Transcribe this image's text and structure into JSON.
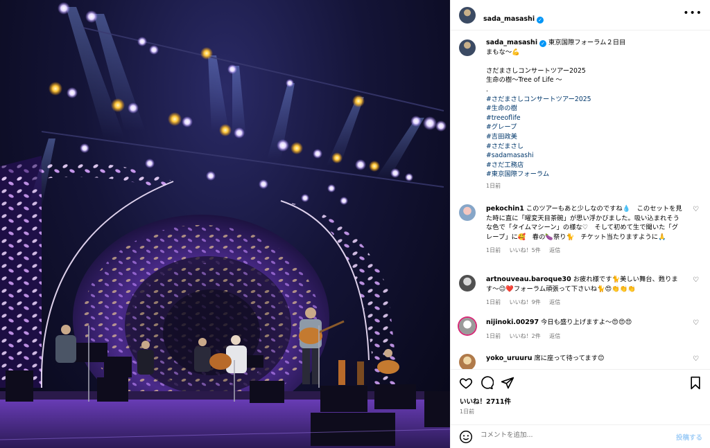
{
  "post": {
    "username": "sada_masashi",
    "verified_icon": "verified-badge-icon",
    "more_icon": "more-options-icon"
  },
  "caption": {
    "username": "sada_masashi",
    "line1": "東京国際フォーラム２日目",
    "line2": "まもな〜💪",
    "line3": "さだまさしコンサートツアー2025",
    "line4": "生命の樹〜Tree of Life 〜",
    "line5": ".",
    "hashtags": [
      "#さだまさしコンサートツアー2025",
      "#生命の樹",
      "#treeoflife",
      "#グレープ",
      "#吉田政美",
      "#さだまさし",
      "#sadamasashi",
      "#さだ工務店",
      "#東京国際フォーラム"
    ],
    "time": "1日前"
  },
  "comments": [
    {
      "username": "pekochin1",
      "text": "このツアーもあと少しなのですね💧　このセットを見た時に直に「曜変天目茶碗」が思い浮かびました。吸い込まれそうな色で「タイムマシーン」の様な♡　そして初めて生で聞いた「グレープ」に🥰　春の🍆祭り🐈　チケット当たりますように🙏",
      "time": "1日前",
      "likes": "いいね！5件",
      "reply": "返信"
    },
    {
      "username": "artnouveau.baroque30",
      "text": "お疲れ様です🐈美しい舞台、甦ります〜😉❤️フォーラム頑張って下さいね🐈😍👏👏👏",
      "time": "1日前",
      "likes": "いいね！9件",
      "reply": "返信"
    },
    {
      "username": "nijinoki.00297",
      "text": "今日も盛り上げますよ〜😍😍😍",
      "time": "1日前",
      "likes": "いいね！2件",
      "reply": "返信"
    },
    {
      "username": "yoko_uruuru",
      "text": "席に座って待ってます😊",
      "time": "",
      "likes": "",
      "reply": ""
    }
  ],
  "actions": {
    "like_count": "いいね！2711件",
    "date": "1日前",
    "comment_placeholder": "コメントを追加...",
    "post_label": "投稿する"
  },
  "colors": {
    "accent": "#0095f6",
    "hashtag": "#00376b",
    "muted": "#737373"
  }
}
